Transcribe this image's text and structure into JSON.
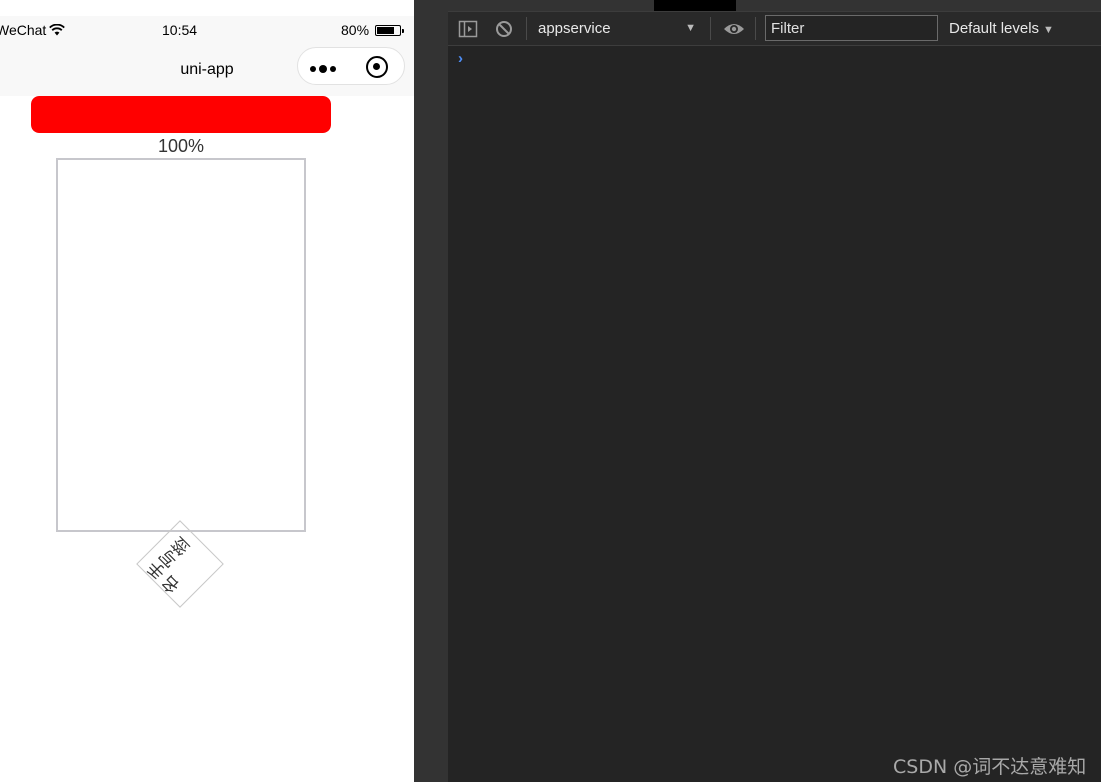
{
  "phone": {
    "status": {
      "carrier": "WeChat",
      "time": "10:54",
      "battery_percent": "80%",
      "battery_level": 0.8
    },
    "nav_title": "uni-app",
    "progress": {
      "percent_label": "100%",
      "value": 1.0,
      "fill_color": "#ff0000"
    },
    "stamp_text": "手写签名"
  },
  "devtools": {
    "context": "appservice",
    "filter_placeholder": "Filter",
    "levels": "Default levels",
    "prompt_symbol": "›",
    "accent_color": "#4e8ef7"
  },
  "watermark": "CSDN @词不达意难知"
}
